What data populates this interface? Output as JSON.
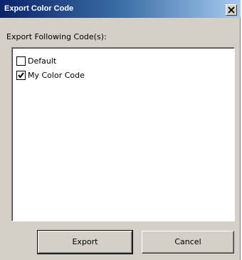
{
  "window": {
    "title": "Export Color Code"
  },
  "icons": {
    "close": "close-icon",
    "checkmark": "checkmark-icon"
  },
  "caption": "Export Following Code(s):",
  "codes": [
    {
      "label": "Default",
      "checked": false
    },
    {
      "label": "My Color Code",
      "checked": true
    }
  ],
  "buttons": {
    "export": "Export",
    "cancel": "Cancel"
  },
  "colors": {
    "titlebar_start": "#0a246a",
    "titlebar_end": "#a6caf0",
    "face": "#d4d0c8"
  }
}
